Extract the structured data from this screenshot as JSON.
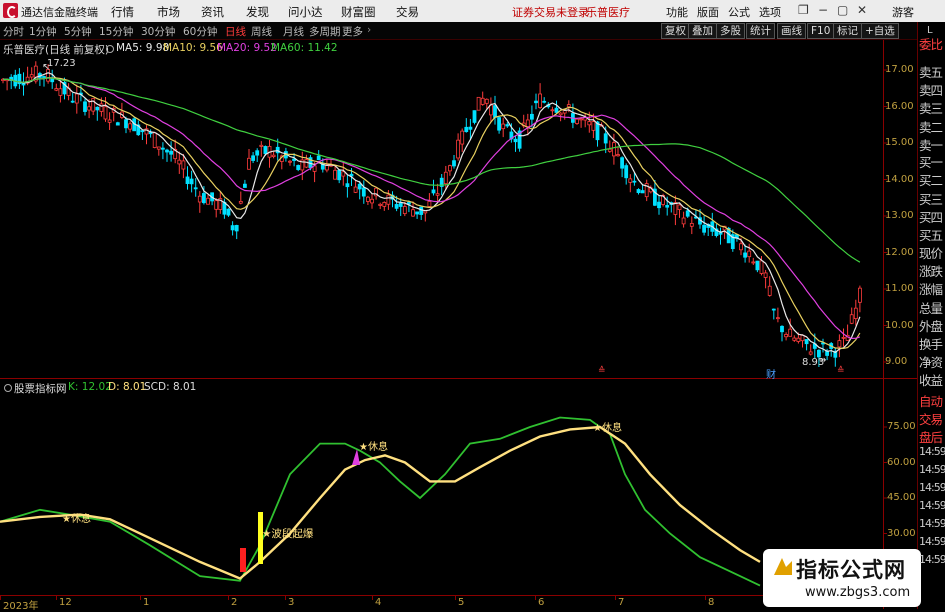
{
  "menubar": {
    "app_title": "通达信金融终端",
    "items": [
      "行情",
      "市场",
      "资讯",
      "发现",
      "问小达",
      "财富圈",
      "交易"
    ],
    "login_warning": "证券交易未登录",
    "stock_name": "乐普医疗",
    "right_items": [
      "功能",
      "版面",
      "公式",
      "选项"
    ],
    "guest": "游客"
  },
  "toolbar": {
    "periods": [
      "分时",
      "1分钟",
      "5分钟",
      "15分钟",
      "30分钟",
      "60分钟",
      "日线",
      "周线",
      "月线",
      "多周期",
      "更多"
    ],
    "active_period": "日线",
    "buttons": [
      "复权",
      "叠加",
      "多股",
      "统计",
      "画线",
      "F10",
      "标记",
      "+自选"
    ]
  },
  "right_panel": {
    "letter": "L",
    "items": [
      "委比",
      "卖五",
      "卖四",
      "卖三",
      "卖二",
      "卖一",
      "买一",
      "买二",
      "买三",
      "买四",
      "买五",
      "现价",
      "涨跌",
      "涨幅",
      "总量",
      "外盘",
      "换手",
      "净资",
      "收益",
      "自动",
      "交易",
      "盘后",
      "14:59",
      "14:59",
      "14:59",
      "14:59",
      "14:59",
      "14:59",
      "14:59"
    ]
  },
  "main_chart": {
    "title": "乐普医疗(日线 前复权)",
    "ma": [
      {
        "label": "MA5: 9.98",
        "color": "#e8e8e8"
      },
      {
        "label": "MA10: 9.56",
        "color": "#e8d060"
      },
      {
        "label": "MA20: 9.52",
        "color": "#e040e0"
      },
      {
        "label": "MA60: 11.42",
        "color": "#40d040"
      }
    ],
    "y_ticks": [
      "17.00",
      "16.00",
      "15.00",
      "14.00",
      "13.00",
      "12.00",
      "11.00",
      "10.00",
      "9.00"
    ],
    "high_label": "17.23",
    "low_label": "8.93",
    "markers": [
      "财"
    ]
  },
  "indicator": {
    "name": "股票指标网",
    "k": "K: 12.02",
    "d": "D: 8.01",
    "scd": "SCD: 8.01",
    "y_ticks": [
      "75.00",
      "60.00",
      "45.00",
      "30.00"
    ],
    "annotations": [
      "休息",
      "休息",
      "休息",
      "波段起爆"
    ]
  },
  "x_axis": [
    "2023年",
    "12",
    "1",
    "2",
    "3",
    "4",
    "5",
    "6",
    "7",
    "8"
  ],
  "watermark": {
    "title": "指标公式网",
    "url": "www.zbgs3.com"
  },
  "colors": {
    "up": "#ff3c3c",
    "down": "#00e0ff",
    "ma60": "#40d040",
    "k_line": "#30c030",
    "d_line": "#ffe080"
  }
}
